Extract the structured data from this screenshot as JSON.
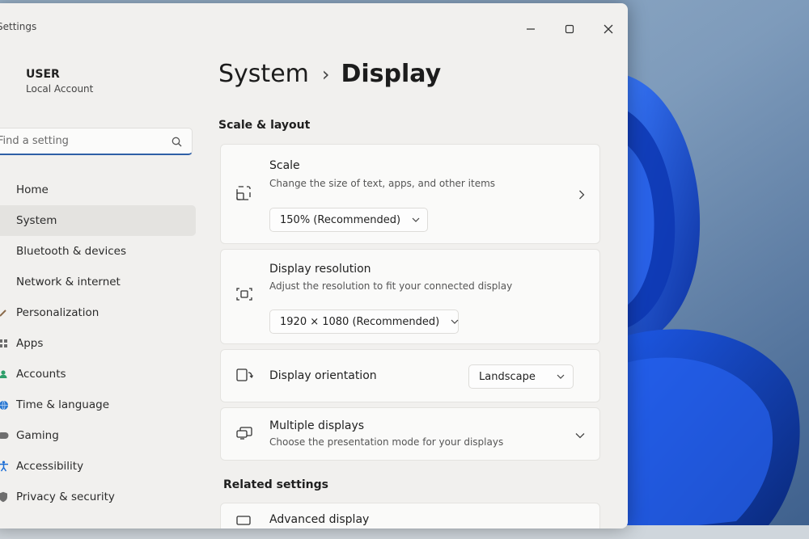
{
  "window": {
    "title": "Settings"
  },
  "user": {
    "name": "USER",
    "account_type": "Local Account"
  },
  "search": {
    "placeholder": "Find a setting"
  },
  "sidebar": {
    "items": [
      {
        "label": "Home",
        "icon": "home-icon"
      },
      {
        "label": "System",
        "icon": "system-icon",
        "active": true
      },
      {
        "label": "Bluetooth & devices",
        "icon": "bluetooth-icon"
      },
      {
        "label": "Network & internet",
        "icon": "network-icon"
      },
      {
        "label": "Personalization",
        "icon": "brush-icon"
      },
      {
        "label": "Apps",
        "icon": "apps-icon"
      },
      {
        "label": "Accounts",
        "icon": "accounts-icon"
      },
      {
        "label": "Time & language",
        "icon": "globe-icon"
      },
      {
        "label": "Gaming",
        "icon": "gamepad-icon"
      },
      {
        "label": "Accessibility",
        "icon": "accessibility-icon"
      },
      {
        "label": "Privacy & security",
        "icon": "shield-icon"
      }
    ]
  },
  "breadcrumb": {
    "parent": "System",
    "separator": "›",
    "current": "Display"
  },
  "sections": {
    "scale_layout": "Scale & layout",
    "related": "Related settings"
  },
  "scale": {
    "title": "Scale",
    "description": "Change the size of text, apps, and other items",
    "value": "150% (Recommended)"
  },
  "resolution": {
    "title": "Display resolution",
    "description": "Adjust the resolution to fit your connected display",
    "value": "1920 × 1080 (Recommended)"
  },
  "orientation": {
    "title": "Display orientation",
    "value": "Landscape"
  },
  "multiple_displays": {
    "title": "Multiple displays",
    "description": "Choose the presentation mode for your displays"
  },
  "advanced_display": {
    "title": "Advanced display"
  },
  "colors": {
    "accent": "#2e5fa6",
    "window_bg": "#f1f0ee",
    "card_bg": "#fafaf9",
    "wallpaper_blue": "#1f4fd1"
  }
}
